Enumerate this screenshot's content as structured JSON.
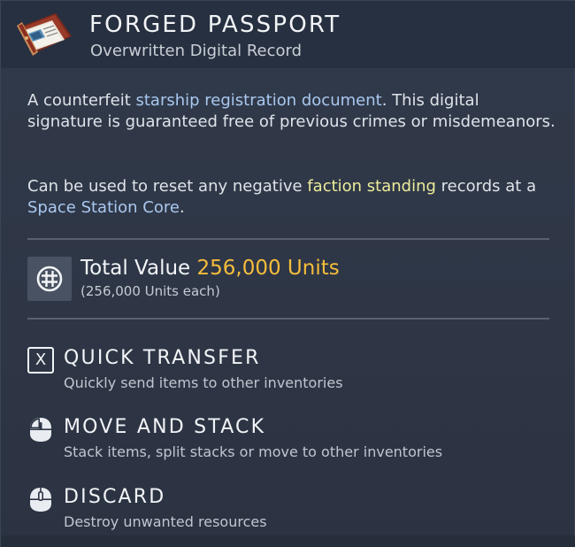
{
  "item": {
    "title": "FORGED PASSPORT",
    "subtitle": "Overwritten Digital Record",
    "icon": "forged-passport-icon"
  },
  "description": {
    "p1_before": "A counterfeit ",
    "p1_link": "starship registration document",
    "p1_after": ". This digital signature is guaranteed free of previous crimes or misdemeanors.",
    "p2_before": "Can be used to reset any negative ",
    "p2_highlight": "faction standing",
    "p2_middle": " records at a ",
    "p2_link": "Space Station Core",
    "p2_after": "."
  },
  "value": {
    "label": "Total Value",
    "amount": "256,000 Units",
    "each": "(256,000 Units each)",
    "icon": "units-currency-icon"
  },
  "actions": [
    {
      "key": "X",
      "label": "QUICK TRANSFER",
      "desc": "Quickly send items to other inventories",
      "icon": "x-key-icon"
    },
    {
      "label": "MOVE AND STACK",
      "desc": "Stack items, split stacks or move to other inventories",
      "icon": "mouse-left-click-icon"
    },
    {
      "label": "DISCARD",
      "desc": "Destroy unwanted resources",
      "icon": "mouse-middle-click-icon"
    }
  ],
  "colors": {
    "background": "#2d3645",
    "header": "#273040",
    "highlight_blue": "#a9c8f0",
    "highlight_yellow": "#ecec9a",
    "units_gold": "#f6bd3c"
  }
}
